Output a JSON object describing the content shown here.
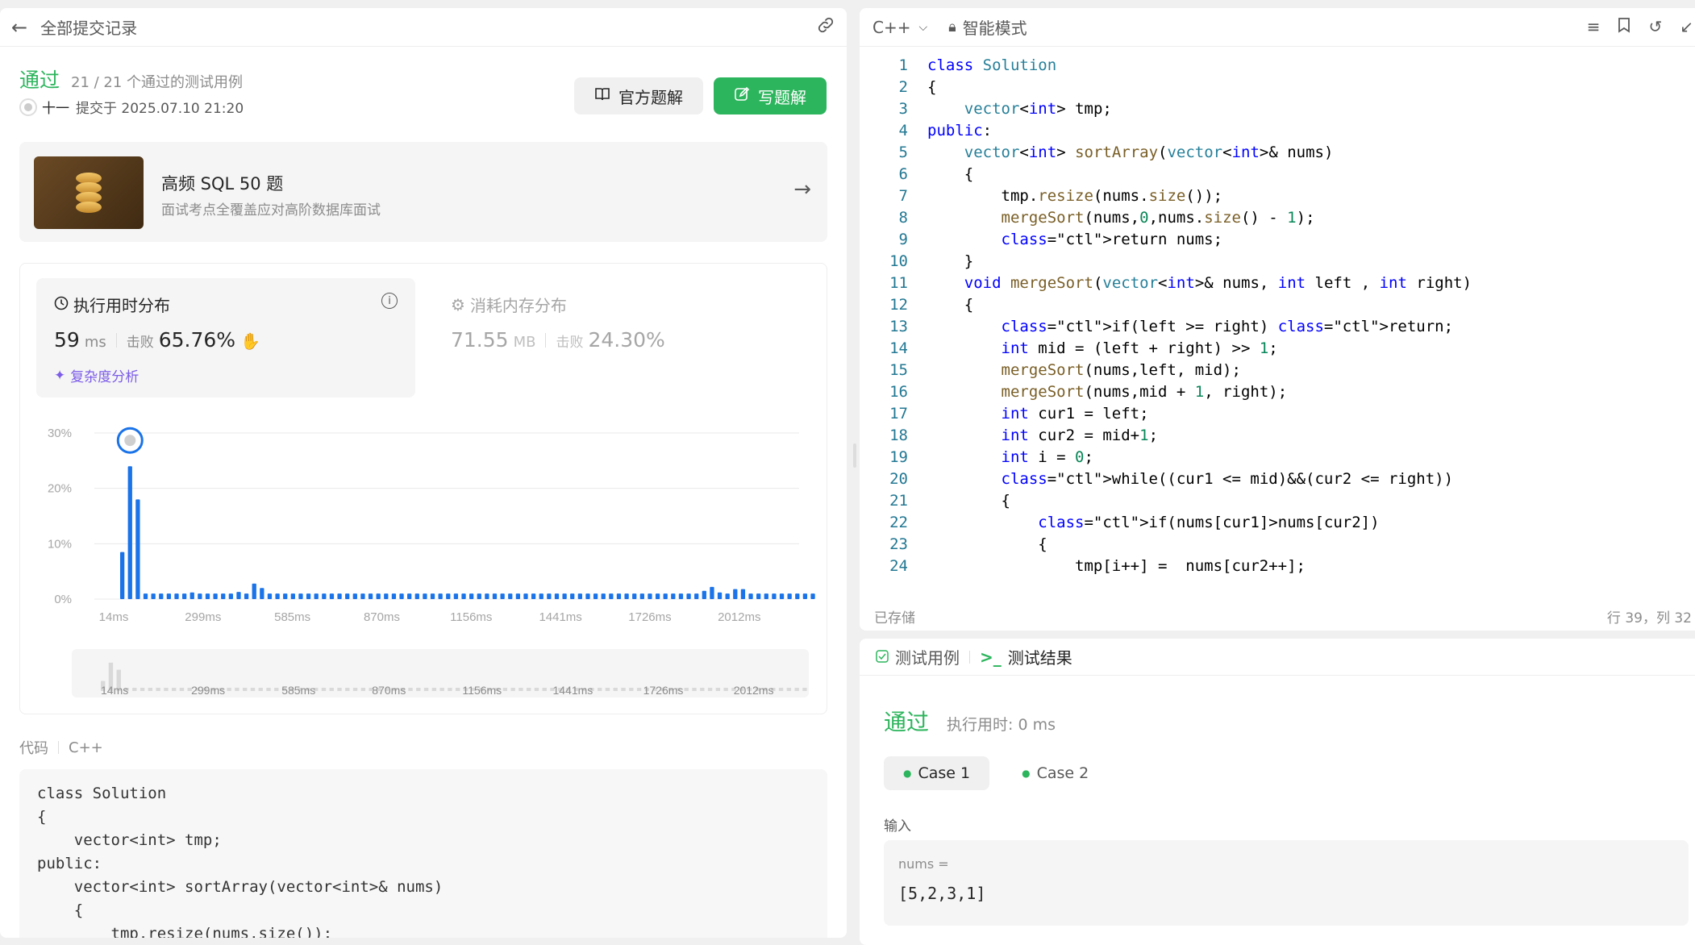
{
  "left": {
    "header_title": "全部提交记录",
    "status": "通过",
    "testcases": "21 / 21 个通过的测试用例",
    "user": "十一",
    "submitted": "提交于 2025.07.10 21:20",
    "btn_official": "官方题解",
    "btn_write": "写题解",
    "sql_title": "高频 SQL 50 题",
    "sql_sub": "面试考点全覆盖应对高阶数据库面试",
    "runtime": {
      "title": "执行用时分布",
      "value": "59",
      "unit": "ms",
      "beat_label": "击败",
      "beat": "65.76%",
      "complexity": "复杂度分析"
    },
    "memory": {
      "title": "消耗内存分布",
      "value": "71.55",
      "unit": "MB",
      "beat_label": "击败",
      "beat": "24.30%"
    },
    "code_label": "代码",
    "code_lang": "C++",
    "code_snippet": "class Solution\n{\n    vector<int> tmp;\npublic:\n    vector<int> sortArray(vector<int>& nums)\n    {\n        tmp.resize(nums.size());"
  },
  "chart_data": {
    "type": "bar",
    "ylabel": "",
    "xlabel": "",
    "yticks": [
      "0%",
      "10%",
      "20%",
      "30%"
    ],
    "ylim": [
      0,
      30
    ],
    "xticks": [
      "14ms",
      "299ms",
      "585ms",
      "870ms",
      "1156ms",
      "1441ms",
      "1726ms",
      "2012ms"
    ],
    "values": [
      8.5,
      24,
      18,
      1,
      1,
      1,
      1,
      1,
      1,
      1.2,
      1,
      1,
      1,
      1,
      1,
      1.3,
      1,
      2.8,
      2,
      1,
      1,
      1,
      1,
      1,
      1,
      1,
      1,
      1,
      1,
      1,
      1,
      1,
      1,
      1,
      1,
      1,
      1,
      1,
      1,
      1,
      1,
      1,
      1,
      1,
      1,
      1,
      1,
      1,
      1,
      1,
      1,
      1,
      1,
      1,
      1,
      1,
      1,
      1,
      1,
      1,
      1,
      1,
      1,
      1,
      1,
      1,
      1,
      1,
      1,
      1,
      1,
      1,
      1,
      1,
      1,
      1.5,
      2.2,
      1.2,
      1,
      1.8,
      1.8,
      1,
      1,
      1,
      1,
      1,
      1,
      1,
      1,
      1
    ],
    "highlight_index": 1,
    "color": "#1a73e8"
  },
  "editor": {
    "lang": "C++",
    "mode": "智能模式",
    "saved": "已存储",
    "position": "行 39，列 32",
    "lines": [
      "class Solution",
      "{",
      "    vector<int> tmp;",
      "public:",
      "    vector<int> sortArray(vector<int>& nums)",
      "    {",
      "        tmp.resize(nums.size());",
      "        mergeSort(nums,0,nums.size() - 1);",
      "        return nums;",
      "    }",
      "    void mergeSort(vector<int>& nums, int left , int right)",
      "    {",
      "        if(left >= right) return;",
      "        int mid = (left + right) >> 1;",
      "        mergeSort(nums,left, mid);",
      "        mergeSort(nums,mid + 1, right);",
      "        int cur1 = left;",
      "        int cur2 = mid+1;",
      "        int i = 0;",
      "        while((cur1 <= mid)&&(cur2 <= right))",
      "        {",
      "            if(nums[cur1]>nums[cur2])",
      "            {",
      "                tmp[i++] =  nums[cur2++];"
    ]
  },
  "tests": {
    "tab_cases": "测试用例",
    "tab_results": "测试结果",
    "status": "通过",
    "time": "执行用时: 0 ms",
    "case1": "Case 1",
    "case2": "Case 2",
    "input_label": "输入",
    "input_name": "nums =",
    "input_value": "[5,2,3,1]"
  }
}
